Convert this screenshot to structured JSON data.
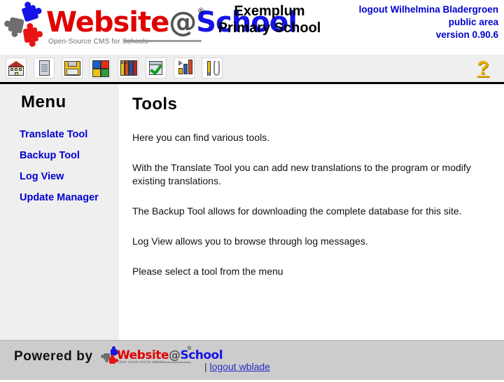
{
  "header": {
    "logo": {
      "wordmark_part1": "Website",
      "wordmark_at": "@",
      "wordmark_part2": "School",
      "registered_mark": "®",
      "tagline": "Open-Source CMS for Schools"
    },
    "site_title_line1": "Exemplum",
    "site_title_line2": "Primary School",
    "user": {
      "logout_link": "logout Wilhelmina Bladergroen",
      "area": "public area",
      "version": "version 0.90.6"
    }
  },
  "toolbar": {
    "buttons": [
      {
        "name": "school-icon",
        "title": "School"
      },
      {
        "name": "page-icon",
        "title": "Page"
      },
      {
        "name": "save-icon",
        "title": "Save"
      },
      {
        "name": "pagemanager-icon",
        "title": "Page Manager"
      },
      {
        "name": "areamanager-icon",
        "title": "Area Manager"
      },
      {
        "name": "usermanager-icon",
        "title": "User Manager"
      },
      {
        "name": "statistics-icon",
        "title": "Statistics"
      },
      {
        "name": "tools-icon",
        "title": "Tools"
      }
    ],
    "help_glyph": "?"
  },
  "sidebar": {
    "title": "Menu",
    "items": [
      {
        "label": "Translate Tool"
      },
      {
        "label": "Backup Tool"
      },
      {
        "label": "Log View"
      },
      {
        "label": "Update Manager"
      }
    ]
  },
  "content": {
    "title": "Tools",
    "paragraphs": [
      "Here you can find various tools.",
      "With the Translate Tool you can add new translations to the program or modify existing translations.",
      "The Backup Tool allows for downloading the complete database for this site.",
      "Log View allows you to browse through log messages.",
      "Please select a tool from the menu"
    ]
  },
  "footer": {
    "powered_by": "Powered by",
    "logo": {
      "wordmark_part1": "Website",
      "wordmark_at": "@",
      "wordmark_part2": "School",
      "registered_mark": "®",
      "tagline": "Open source cms for schools"
    },
    "separator": "|",
    "logout_label": "logout wblade"
  },
  "colors": {
    "link_blue": "#0000d0",
    "logo_red": "#e00000",
    "logo_blue": "#1414e6",
    "logo_gray": "#6e6e6e",
    "toolbar_bg": "#efefef",
    "footer_bg": "#cccccc",
    "help_yellow": "#e8b000"
  }
}
